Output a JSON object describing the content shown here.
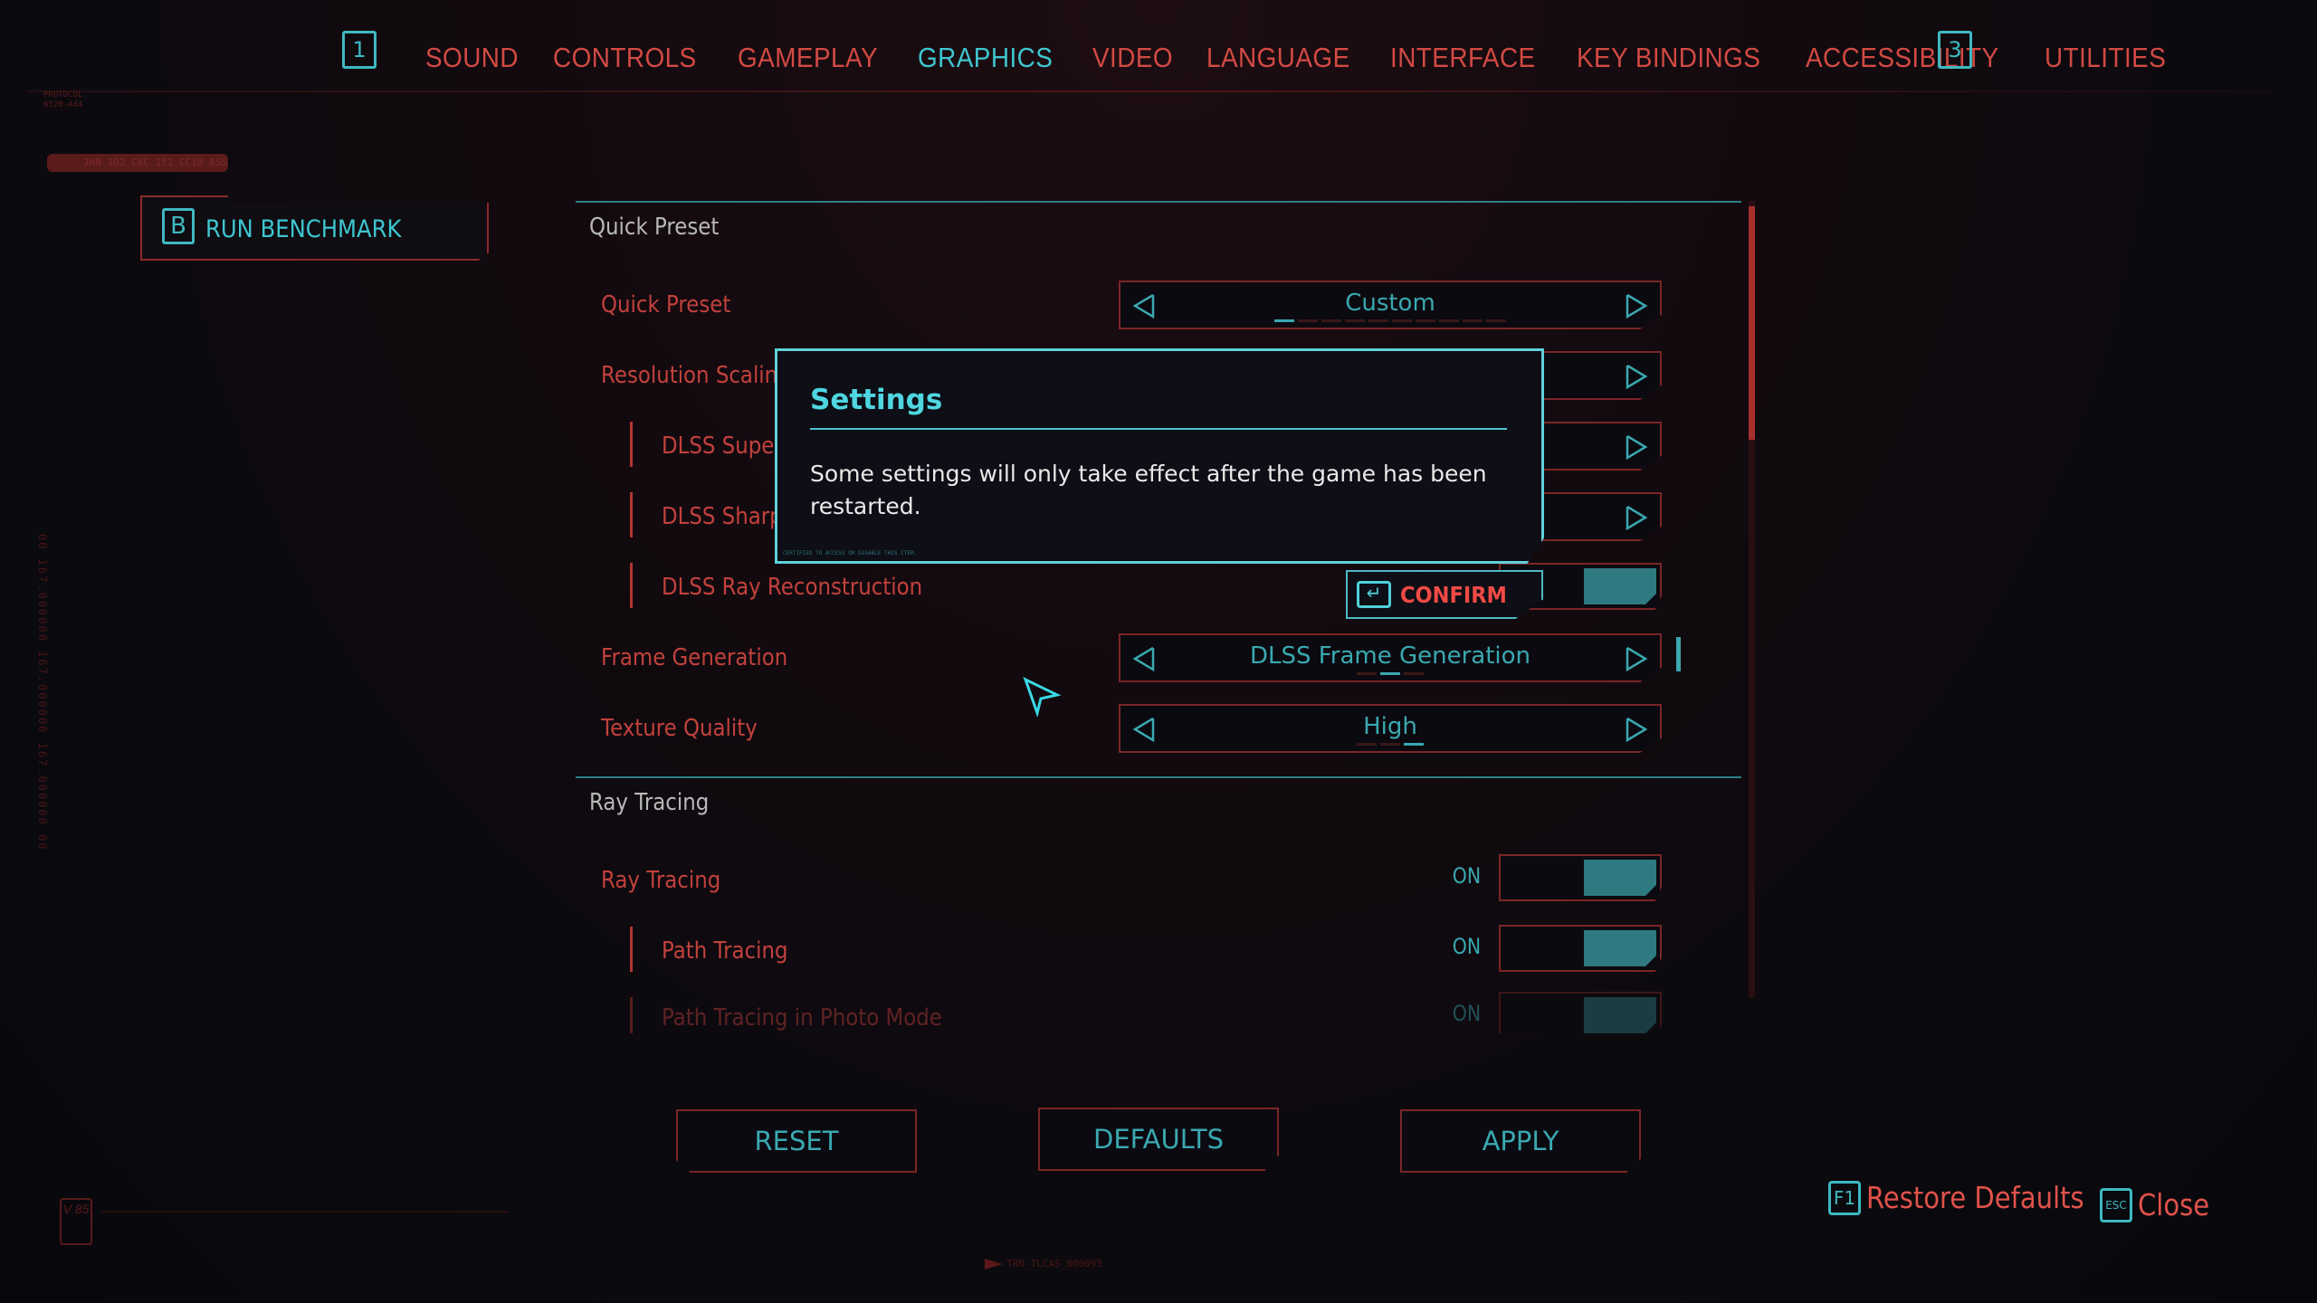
{
  "top_nav": {
    "left_key": "1",
    "right_key": "3",
    "tabs": [
      {
        "label": "SOUND",
        "active": false
      },
      {
        "label": "CONTROLS",
        "active": false
      },
      {
        "label": "GAMEPLAY",
        "active": false
      },
      {
        "label": "GRAPHICS",
        "active": true
      },
      {
        "label": "VIDEO",
        "active": false
      },
      {
        "label": "LANGUAGE",
        "active": false
      },
      {
        "label": "INTERFACE",
        "active": false
      },
      {
        "label": "KEY BINDINGS",
        "active": false
      },
      {
        "label": "ACCESSIBILITY",
        "active": false
      },
      {
        "label": "UTILITIES",
        "active": false
      }
    ]
  },
  "decor": {
    "protocol_line1": "PROTOCOL",
    "protocol_line2": "6520-A44",
    "serial": "JHN 102 CKC 151 CC10 AS5",
    "vertical_code": "00 167.000000 167.000000 167.000000 00",
    "footer_code": "TRN_TLCAS_800095",
    "badge": "V 85"
  },
  "benchmark": {
    "key": "B",
    "label": "RUN BENCHMARK"
  },
  "sections": {
    "quick_preset": {
      "title": "Quick Preset",
      "rows": [
        {
          "label": "Quick Preset",
          "value": "Custom"
        },
        {
          "label": "Resolution Scaling",
          "value": ""
        },
        {
          "label": "DLSS Super Resolution",
          "value": ""
        },
        {
          "label": "DLSS Sharpness",
          "value": ""
        },
        {
          "label": "DLSS Ray Reconstruction",
          "value": "ON"
        },
        {
          "label": "Frame Generation",
          "value": "DLSS Frame Generation"
        },
        {
          "label": "Texture Quality",
          "value": "High"
        }
      ]
    },
    "ray_tracing": {
      "title": "Ray Tracing",
      "rows": [
        {
          "label": "Ray Tracing",
          "value": "ON"
        },
        {
          "label": "Path Tracing",
          "value": "ON"
        },
        {
          "label": "Path Tracing in Photo Mode",
          "value": "ON"
        }
      ]
    }
  },
  "modal": {
    "title": "Settings",
    "body": "Some settings will only take effect after the game has been restarted.",
    "fine_print": "CERTIFIED TO ACCESS OR DISABLE THIS ITEM.",
    "confirm_label": "CONFIRM"
  },
  "bottom_buttons": {
    "reset": "RESET",
    "defaults": "DEFAULTS",
    "apply": "APPLY"
  },
  "hints": [
    {
      "key": "F1",
      "label": "Restore Defaults"
    },
    {
      "key": "ESC",
      "label": "Close"
    }
  ],
  "colors": {
    "accent_red": "#e0524a",
    "accent_cyan": "#3ec6d0",
    "toggle_fill": "#2e7a80"
  }
}
